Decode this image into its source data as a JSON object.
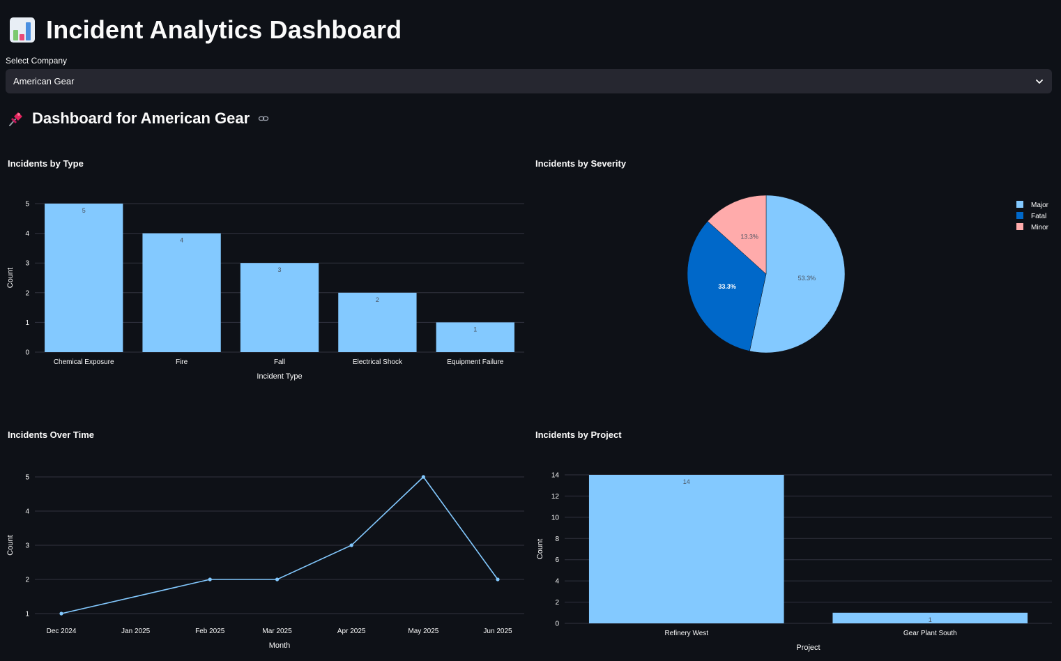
{
  "app": {
    "title": "Incident Analytics Dashboard",
    "icon": "bar-chart-icon"
  },
  "company_select": {
    "label": "Select Company",
    "value": "American Gear"
  },
  "subheader": {
    "title": "Dashboard for American Gear",
    "icon": "pushpin-icon",
    "anchor_icon": "link-icon"
  },
  "colors": {
    "background": "#0e1117",
    "light_blue": "#83c9ff",
    "dark_blue": "#0068c9",
    "pink": "#ffabab",
    "gridline": "#31333f"
  },
  "charts": {
    "type_title": "Incidents by Type",
    "severity_title": "Incidents by Severity",
    "time_title": "Incidents Over Time",
    "project_title": "Incidents by Project"
  },
  "chart_data": [
    {
      "type": "bar",
      "title": "Incidents by Type",
      "categories": [
        "Chemical Exposure",
        "Fire",
        "Fall",
        "Electrical Shock",
        "Equipment Failure"
      ],
      "values": [
        5,
        4,
        3,
        2,
        1
      ],
      "xlabel": "Incident Type",
      "ylabel": "Count",
      "ylim": [
        0,
        5
      ],
      "yticks": [
        0,
        1,
        2,
        3,
        4,
        5
      ],
      "data_labels": true,
      "grid": true
    },
    {
      "type": "pie",
      "title": "Incidents by Severity",
      "labels": [
        "Major",
        "Fatal",
        "Minor"
      ],
      "values": [
        53.3,
        33.3,
        13.3
      ],
      "value_labels": [
        "53.3%",
        "33.3%",
        "13.3%"
      ],
      "colors": [
        "#83c9ff",
        "#0068c9",
        "#ffabab"
      ],
      "legend": "top-right"
    },
    {
      "type": "line",
      "title": "Incidents Over Time",
      "x": [
        "Dec 2024",
        "Feb 2025",
        "Mar 2025",
        "Apr 2025",
        "May 2025",
        "Jun 2025"
      ],
      "y": [
        1,
        2,
        2,
        3,
        5,
        2
      ],
      "x_ticks": [
        "Dec 2024",
        "Jan 2025",
        "Feb 2025",
        "Mar 2025",
        "Apr 2025",
        "May 2025",
        "Jun 2025"
      ],
      "xlabel": "Month",
      "ylabel": "Count",
      "ylim": [
        1,
        5
      ],
      "yticks": [
        1,
        2,
        3,
        4,
        5
      ],
      "grid": true
    },
    {
      "type": "bar",
      "title": "Incidents by Project",
      "categories": [
        "Refinery West",
        "Gear Plant South"
      ],
      "values": [
        14,
        1
      ],
      "xlabel": "Project",
      "ylabel": "Count",
      "ylim": [
        0,
        14
      ],
      "yticks": [
        0,
        2,
        4,
        6,
        8,
        10,
        12,
        14
      ],
      "data_labels": true,
      "grid": true
    }
  ]
}
